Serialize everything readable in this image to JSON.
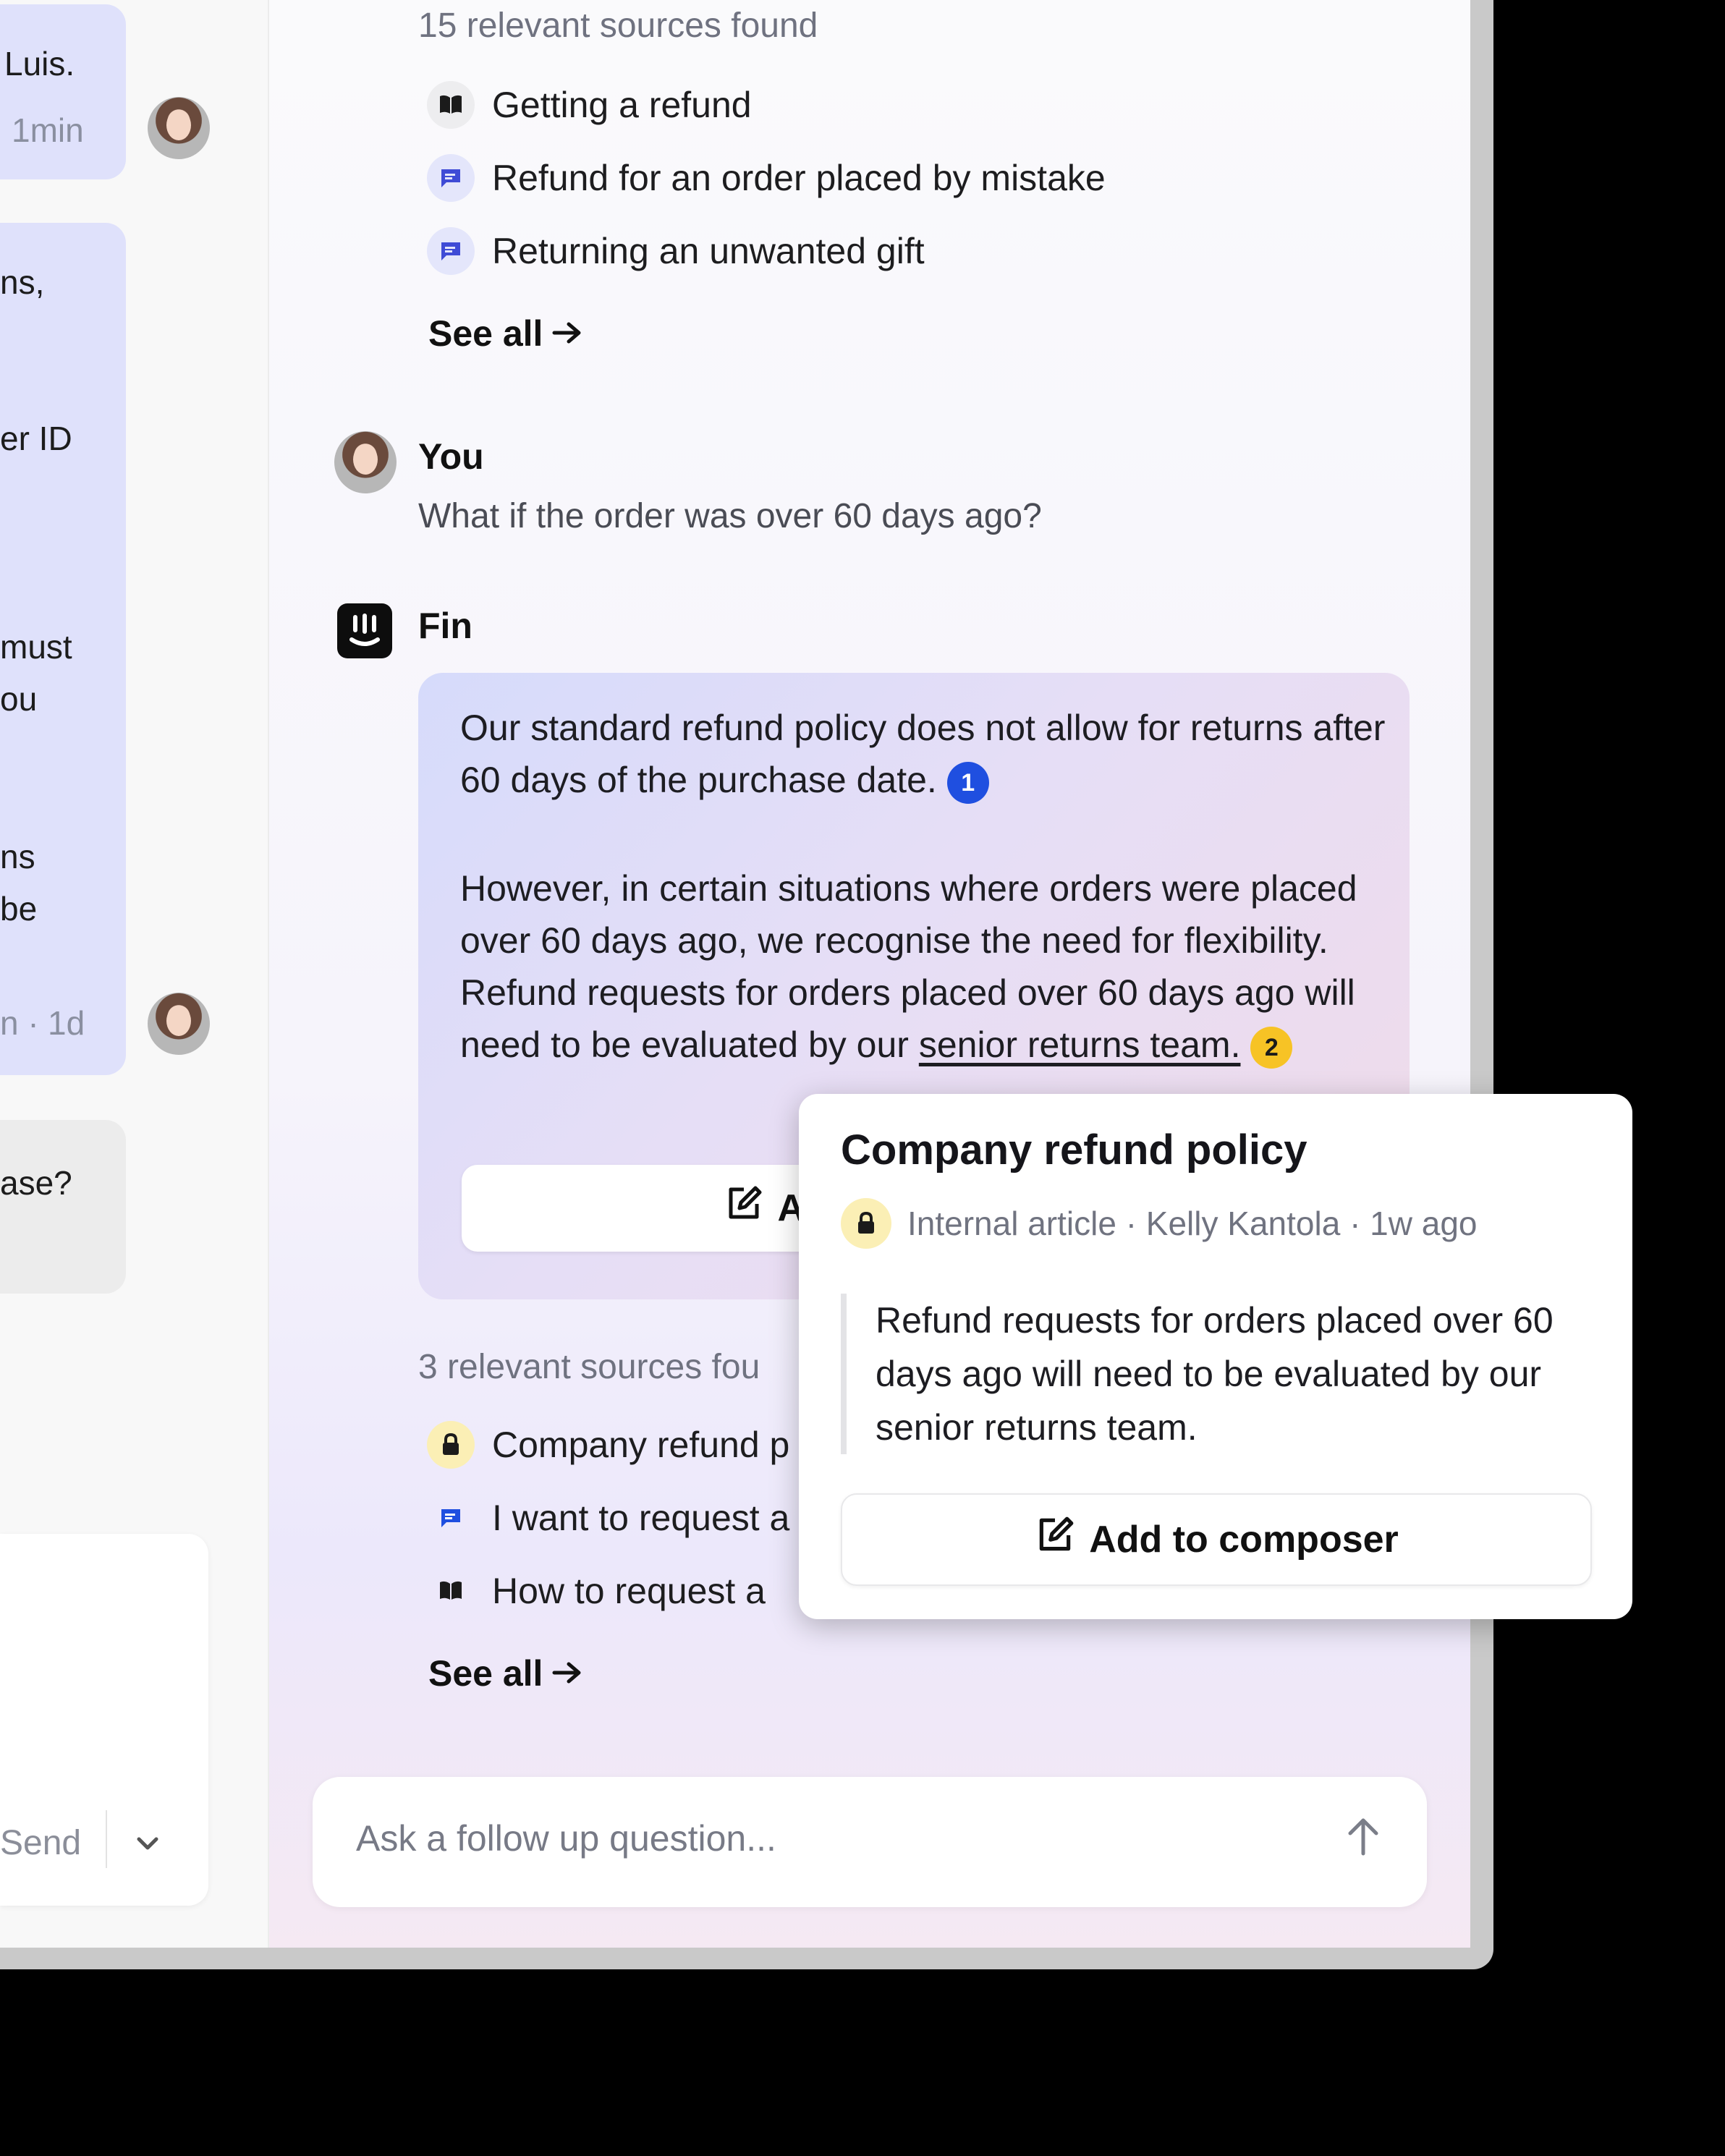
{
  "conversation": {
    "msg1_line1": "Luis.",
    "msg1_time": "1min",
    "msg2_lines": [
      "ns,",
      "er ID",
      "must",
      "ou",
      "ns",
      "be"
    ],
    "msg2_footer": "n ·",
    "msg2_time": "1d",
    "msg3_text": "ase?",
    "composer_send": "Send"
  },
  "copilot": {
    "sources_top": {
      "count_text": "15 relevant sources found",
      "items": [
        {
          "icon": "book-icon",
          "label": "Getting a refund"
        },
        {
          "icon": "chat-icon",
          "label": "Refund for an order placed by mistake"
        },
        {
          "icon": "chat-icon",
          "label": "Returning an unwanted gift"
        }
      ],
      "see_all": "See all"
    },
    "user": {
      "name": "You",
      "question": "What if the order was over 60 days ago?"
    },
    "fin": {
      "name": "Fin",
      "para1": "Our standard refund policy does not allow for returns after 60 days of the purchase date.",
      "cite1": "1",
      "para2_plain": "However, in certain situations where orders were placed over 60 days ago, we recognise the need for flexibility. Refund requests for orders placed over 60 days ago will need to be evaluated by our ",
      "para2_link": "senior returns team.",
      "cite2": "2",
      "add_button_partial": "Add"
    },
    "sources_bottom": {
      "count_text": "3 relevant sources fou",
      "items": [
        {
          "icon": "lock-icon",
          "label": "Company refund p"
        },
        {
          "icon": "chat-icon",
          "label": "I want to request a"
        },
        {
          "icon": "book-icon",
          "label": "How to request a"
        }
      ],
      "see_all": "See all"
    },
    "followup_placeholder": "Ask a follow up question..."
  },
  "popup": {
    "title": "Company refund policy",
    "meta": "Internal article · Kelly Kantola · 1w ago",
    "quote": "Refund requests for orders placed over 60 days ago will need to be evaluated by our senior returns team.",
    "button": "Add to composer"
  },
  "colors": {
    "cite_blue": "#1f4fe0",
    "cite_yellow": "#f7c325",
    "user_bubble": "#dfe1fb"
  }
}
